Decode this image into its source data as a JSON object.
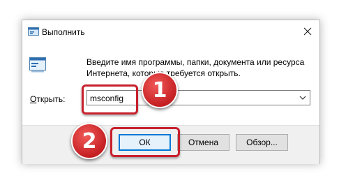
{
  "dialog": {
    "title": "Выполнить",
    "description": "Введите имя программы, папки, документа или ресурса Интернета, которые требуется открыть.",
    "open_label_mnemonic": "О",
    "open_label_rest": "ткрыть:",
    "command_value": "msconfig",
    "buttons": {
      "ok": "ОК",
      "cancel": "Отмена",
      "browse": "Обзор..."
    }
  },
  "annotations": {
    "step1": "1",
    "step2": "2",
    "highlight_color": "#c8202c"
  },
  "colors": {
    "accent": "#0078d7",
    "footer": "#f0f0f0"
  },
  "icons": {
    "title": "run-icon",
    "close": "close-icon",
    "dropdown": "chevron-down-icon",
    "large": "run-icon"
  }
}
